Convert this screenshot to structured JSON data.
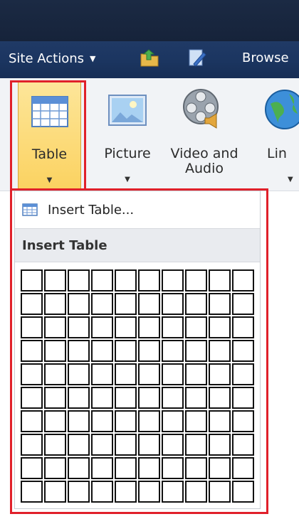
{
  "actionbar": {
    "site_actions_label": "Site Actions",
    "site_actions_caret": "▼",
    "browse_label": "Browse"
  },
  "ribbon": {
    "buttons": [
      {
        "label": "Table",
        "icon": "table-icon",
        "drop": "▼"
      },
      {
        "label": "Picture",
        "icon": "picture-icon",
        "drop": "▼"
      },
      {
        "label": "Video and Audio",
        "icon": "video-audio-icon",
        "drop": ""
      },
      {
        "label": "Lin",
        "icon": "globe-link-icon",
        "drop": "▼"
      }
    ]
  },
  "dropdown": {
    "insert_table_item": "Insert Table...",
    "section_header": "Insert Table",
    "grid_rows": 10,
    "grid_cols": 10
  },
  "colors": {
    "highlight": "#e0202a",
    "active_button": "#fbd260",
    "actionbar": "#1b3560"
  }
}
